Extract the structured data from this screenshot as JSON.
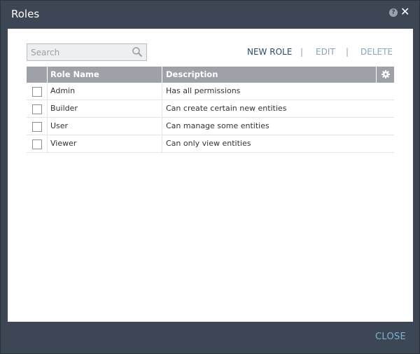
{
  "dialog": {
    "title": "Roles",
    "help_glyph": "?",
    "close_glyph": "✕",
    "close_label": "CLOSE"
  },
  "search": {
    "placeholder": "Search",
    "value": ""
  },
  "toolbar": {
    "new_label": "NEW ROLE",
    "edit_label": "EDIT",
    "delete_label": "DELETE",
    "separator": "|"
  },
  "table": {
    "columns": [
      "Role Name",
      "Description"
    ],
    "rows": [
      {
        "name": "Admin",
        "description": "Has all permissions"
      },
      {
        "name": "Builder",
        "description": "Can create certain new entities"
      },
      {
        "name": "User",
        "description": "Can manage some entities"
      },
      {
        "name": "Viewer",
        "description": "Can only view entities"
      }
    ]
  },
  "colors": {
    "frame": "#3d4654",
    "header": "#9ea2a8",
    "link_active": "#2b4a6b",
    "link_disabled": "#8da4b8",
    "close": "#7fb2d2"
  }
}
